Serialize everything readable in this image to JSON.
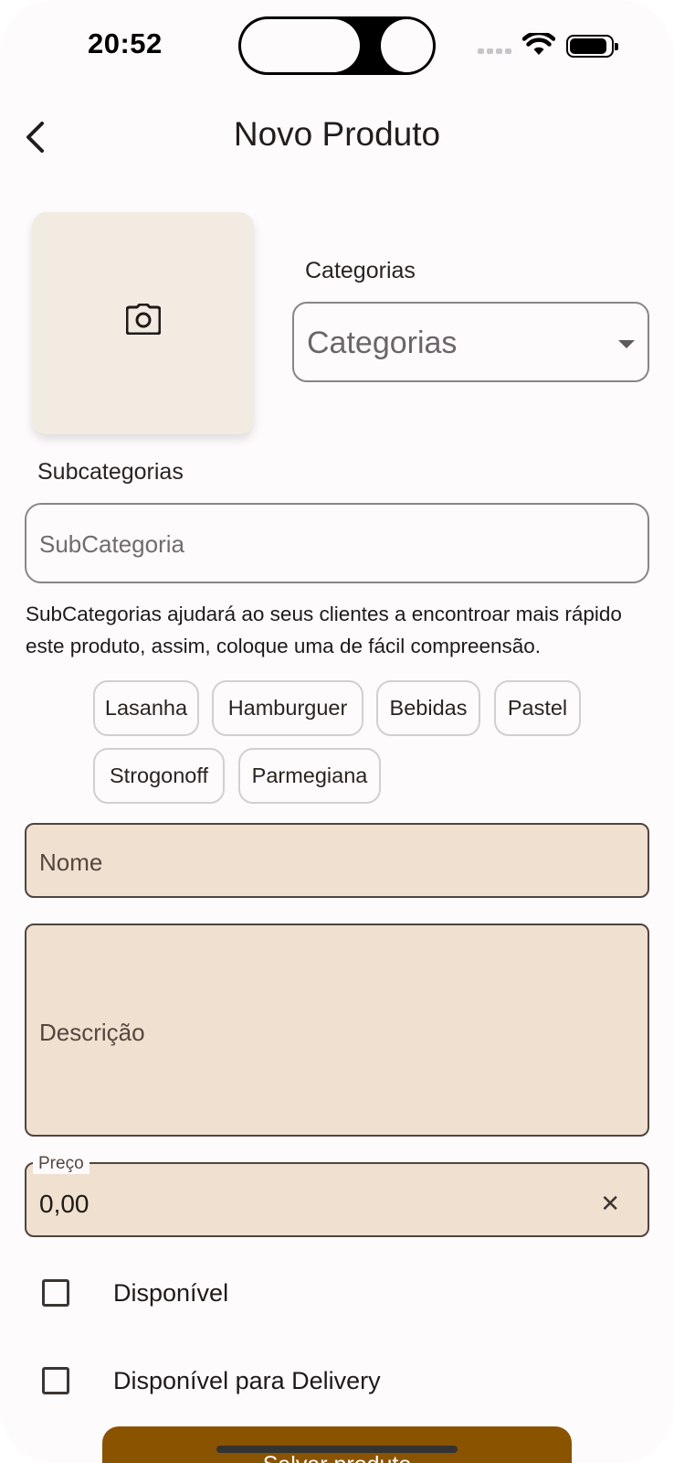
{
  "status_bar": {
    "time": "20:52"
  },
  "header": {
    "title": "Novo Produto",
    "back_icon": "chevron-left-icon"
  },
  "photo": {
    "icon": "camera-icon"
  },
  "categories": {
    "label": "Categorias",
    "selected": "Categorias"
  },
  "subcategories": {
    "label": "Subcategorias",
    "placeholder": "SubCategoria",
    "helper": "SubCategorias ajudará ao seus clientes a encontroar mais rápido este produto, assim, coloque uma de fácil compreensão.",
    "chips": [
      "Lasanha",
      "Hamburguer",
      "Bebidas",
      "Pastel",
      "Strogonoff",
      "Parmegiana"
    ]
  },
  "form": {
    "name_placeholder": "Nome",
    "description_placeholder": "Descrição",
    "price_label": "Preço",
    "price_value": "0,00",
    "clear_icon": "close-icon"
  },
  "options": {
    "available": "Disponível",
    "delivery": "Disponível para Delivery"
  },
  "actions": {
    "save": "Salvar produto"
  },
  "colors": {
    "field_fill": "#f0e0d0",
    "photo_fill": "#f1ebe2",
    "primary": "#8a5300"
  }
}
